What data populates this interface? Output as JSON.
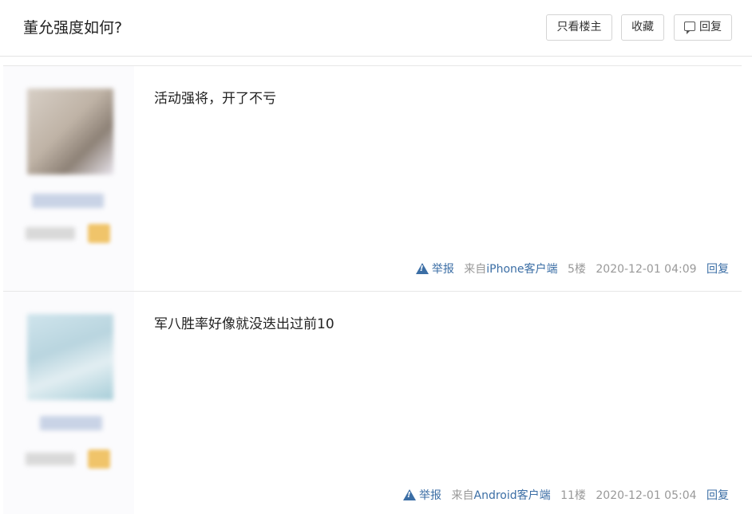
{
  "thread": {
    "title": "董允强度如何?",
    "buttons": {
      "only_op": "只看楼主",
      "favorite": "收藏",
      "reply": "回复"
    }
  },
  "posts": [
    {
      "content": "活动强将，开了不亏",
      "report_label": "举报",
      "source_prefix": "来自",
      "device": "iPhone客户端",
      "floor": "5楼",
      "time": "2020-12-01 04:09",
      "reply_label": "回复"
    },
    {
      "content": "军八胜率好像就没迭出过前10",
      "report_label": "举报",
      "source_prefix": "来自",
      "device": "Android客户端",
      "floor": "11楼",
      "time": "2020-12-01 05:04",
      "reply_label": "回复"
    }
  ],
  "colors": {
    "link": "#3b6ea5",
    "meta": "#999999",
    "author_bg": "#fbfbfd"
  },
  "icons": [
    "reply-icon",
    "warning-icon"
  ]
}
